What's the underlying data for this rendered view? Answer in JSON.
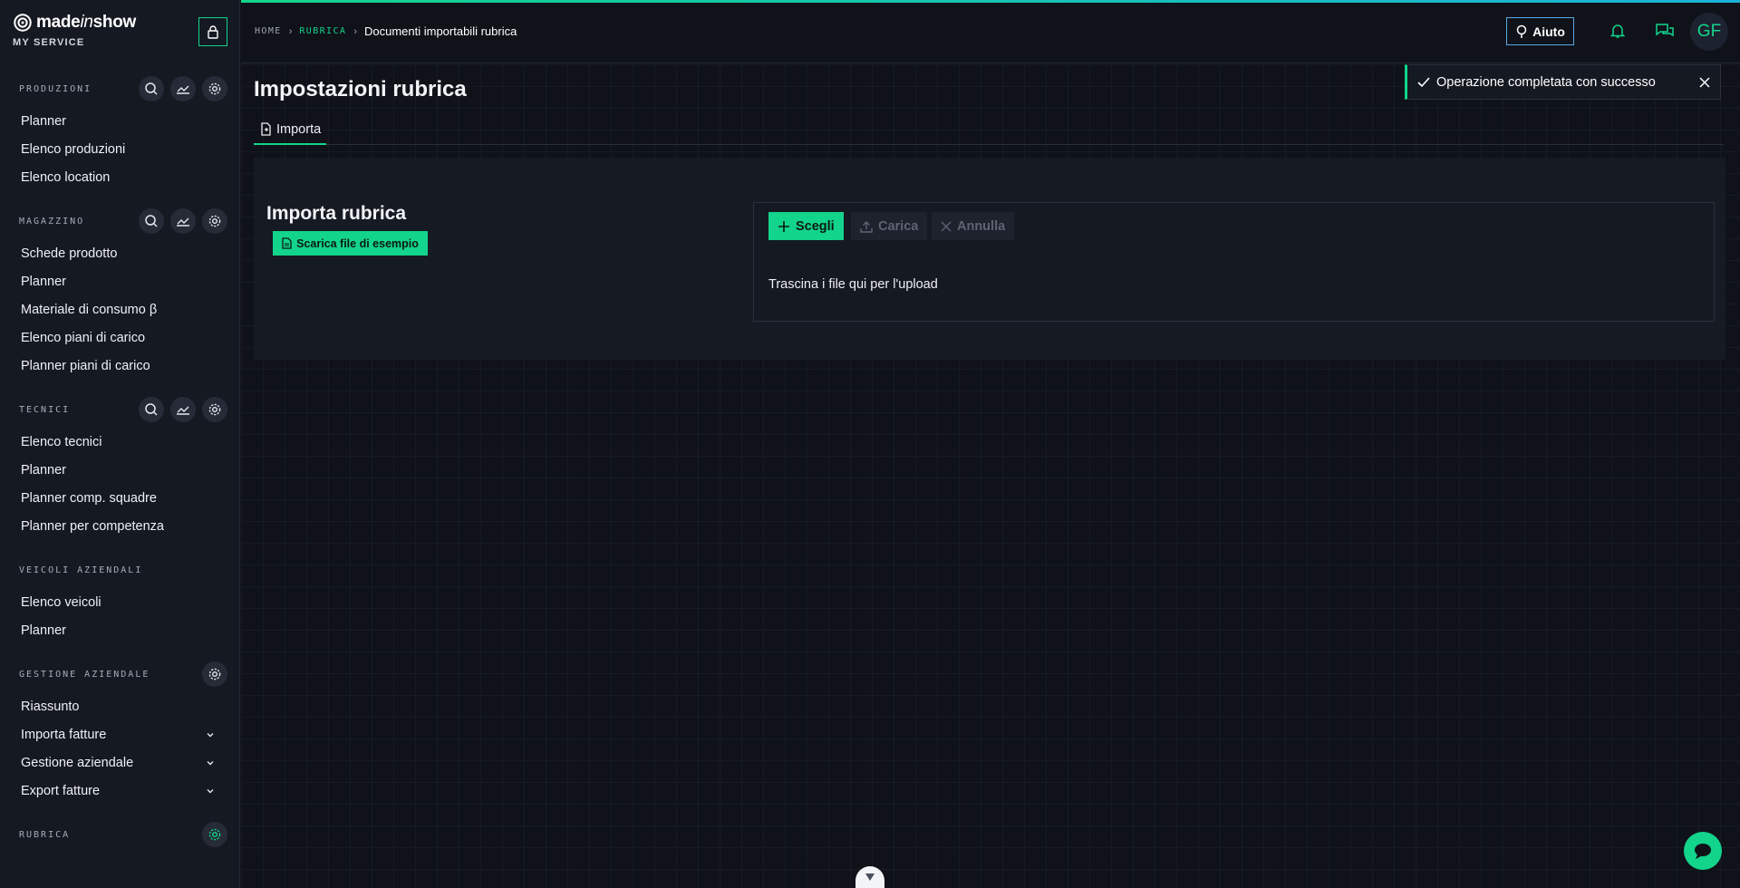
{
  "brand": {
    "name_prefix": "made",
    "name_italic": "in",
    "name_suffix": "show",
    "subtitle": "MY SERVICE"
  },
  "sidebar": {
    "sections": [
      {
        "title": "PRODUZIONI",
        "items": [
          "Planner",
          "Elenco produzioni",
          "Elenco location"
        ]
      },
      {
        "title": "MAGAZZINO",
        "items": [
          "Schede prodotto",
          "Planner",
          "Materiale di consumo β",
          "Elenco piani di carico",
          "Planner piani di carico"
        ]
      },
      {
        "title": "TECNICI",
        "items": [
          "Elenco tecnici",
          "Planner",
          "Planner comp. squadre",
          "Planner per competenza"
        ]
      },
      {
        "title": "VEICOLI AZIENDALI",
        "items": [
          "Elenco veicoli",
          "Planner"
        ]
      },
      {
        "title": "GESTIONE AZIENDALE",
        "items": [
          "Riassunto",
          "Importa fatture",
          "Gestione aziendale",
          "Export fatture"
        ]
      },
      {
        "title": "RUBRICA",
        "items": []
      }
    ]
  },
  "breadcrumb": {
    "home": "HOME",
    "section": "RUBRICA",
    "current": "Documenti importabili rubrica"
  },
  "header": {
    "help_label": "Aiuto",
    "avatar_initials": "GF"
  },
  "page": {
    "title": "Impostazioni rubrica",
    "tab_label": "Importa",
    "panel_title": "Importa rubrica",
    "sample_button": "Scarica file di esempio",
    "upload": {
      "choose_label": "Scegli",
      "load_label": "Carica",
      "cancel_label": "Annulla",
      "drop_text": "Trascina i file qui per l'upload"
    }
  },
  "toast": {
    "message": "Operazione completata con successo"
  },
  "colors": {
    "accent": "#13d48b",
    "help_border": "#5aa9e6",
    "background": "#0f1219",
    "sidebar": "#151922"
  },
  "icons": [
    "lock-icon",
    "search-icon",
    "chart-icon",
    "gear-icon",
    "chevron-down-icon",
    "help-icon",
    "bell-icon",
    "chat-icon",
    "file-icon",
    "plus-icon",
    "upload-icon",
    "close-icon",
    "check-icon",
    "chevron-down-scroll-icon"
  ]
}
